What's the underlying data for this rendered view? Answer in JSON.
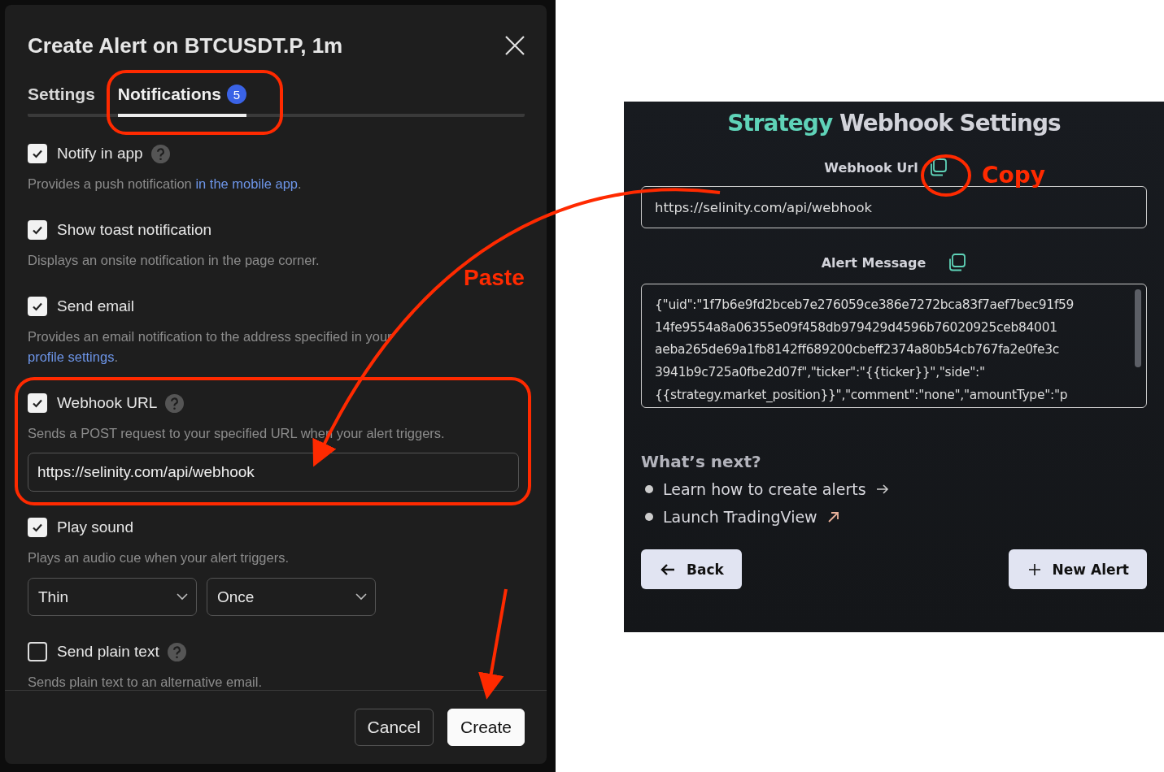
{
  "dialog": {
    "title": "Create Alert on BTCUSDT.P, 1m",
    "tabs": [
      {
        "label": "Settings",
        "selected": false
      },
      {
        "label": "Notifications",
        "selected": true,
        "badge": "5"
      }
    ],
    "options": [
      {
        "label": "Notify in app",
        "checked": true,
        "help": true,
        "description": "Provides a push notification ",
        "link": "in the mobile app",
        "after": "."
      },
      {
        "label": "Show toast notification",
        "checked": true,
        "help": false,
        "description": "Displays an onsite notification in the page corner."
      },
      {
        "label": "Send email",
        "checked": true,
        "help": false,
        "description": "Provides an email notification to the address specified in your ",
        "link": "profile settings",
        "after": "."
      },
      {
        "label": "Webhook URL",
        "checked": true,
        "help": true,
        "description": "Sends a POST request to your specified URL when your alert triggers.",
        "field": "https://selinity.com/api/webhook"
      },
      {
        "label": "Play sound",
        "checked": true,
        "help": false,
        "description": "Plays an audio cue when your alert triggers.",
        "selects": [
          "Thin",
          "Once"
        ]
      },
      {
        "label": "Send plain text",
        "checked": false,
        "help": true,
        "description": "Sends plain text to an alternative email."
      }
    ],
    "buttons": [
      {
        "label": "Cancel",
        "kind": "secondary"
      },
      {
        "label": "Create",
        "kind": "primary"
      }
    ]
  },
  "webhook_panel": {
    "title_accent": "Strategy",
    "title": "Webhook Settings",
    "url_label": "Webhook Url",
    "url": "https://selinity.com/api/webhook",
    "message_label": "Alert Message",
    "message_lines": [
      "{\"uid\":\"1f7b6e9fd2bceb7e276059ce386e7272bca83f7aef7bec91f59",
      "14fe9554a8a06355e09f458db979429d4596b76020925ceb84001",
      "aeba265de69a1fb8142ff689200cbeff2374a80b54cb767fa2e0fe3c",
      "3941b9c725a0fbe2d07f\",\"ticker\":\"{{ticker}}\",\"side\":\"",
      "{{strategy.market_position}}\",\"comment\":\"none\",\"amountType\":\"p"
    ],
    "next_heading": "What’s next?",
    "links": [
      {
        "label": "Learn how to create alerts",
        "kind": "arrow"
      },
      {
        "label": "Launch TradingView",
        "kind": "external"
      }
    ],
    "buttons": [
      {
        "label": "Back",
        "kind": "back"
      },
      {
        "label": "New Alert",
        "kind": "add"
      }
    ]
  },
  "annotations": [
    {
      "text": "Paste",
      "kind": "paste"
    },
    {
      "text": "Copy",
      "kind": "copy"
    }
  ]
}
